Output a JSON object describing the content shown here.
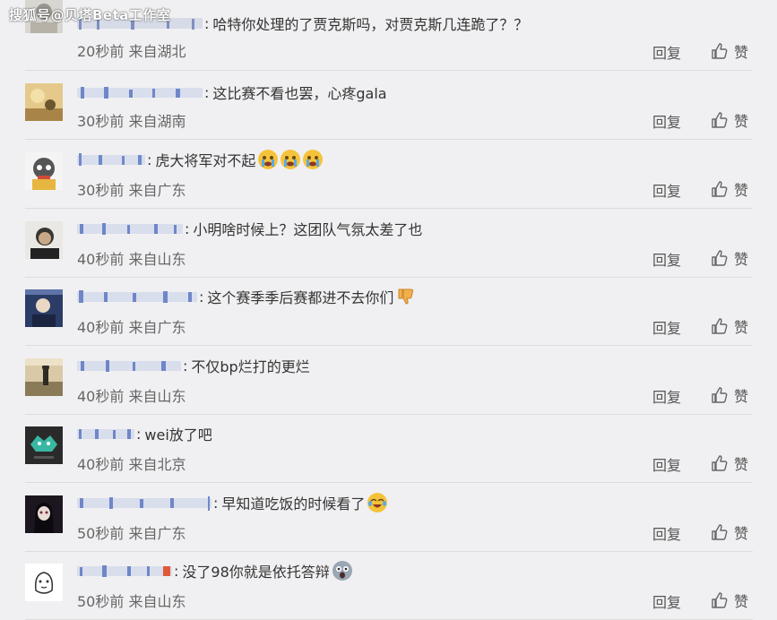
{
  "watermark": "搜狐号@贝塔Beta工作室",
  "actions": {
    "reply_label": "回复",
    "like_label": "赞"
  },
  "comments": [
    {
      "text": "哈特你处理的了贾克斯吗，对贾克斯几连跪了？？",
      "time": "20秒前",
      "location": "来自湖北",
      "emojis": []
    },
    {
      "text": "这比赛不看也罢，心疼gala",
      "time": "30秒前",
      "location": "来自湖南",
      "emojis": []
    },
    {
      "text": "虎大将军对不起",
      "time": "30秒前",
      "location": "来自广东",
      "emojis": [
        "crying-face-icon",
        "crying-face-icon",
        "crying-face-icon"
      ]
    },
    {
      "text": "小明啥时候上？这团队气氛太差了也",
      "time": "40秒前",
      "location": "来自山东",
      "emojis": []
    },
    {
      "text": "这个赛季季后赛都进不去你们",
      "time": "40秒前",
      "location": "来自广东",
      "emojis": [
        "thumbs-down-icon"
      ]
    },
    {
      "text": "不仅bp烂打的更烂",
      "time": "40秒前",
      "location": "来自山东",
      "emojis": []
    },
    {
      "text": "wei放了吧",
      "time": "40秒前",
      "location": "来自北京",
      "emojis": []
    },
    {
      "text": "早知道吃饭的时候看了",
      "time": "50秒前",
      "location": "来自广东",
      "emojis": [
        "laugh-cry-icon"
      ]
    },
    {
      "text": "没了98你就是依托答辩",
      "time": "50秒前",
      "location": "来自山东",
      "emojis": [
        "scared-face-icon"
      ]
    }
  ]
}
